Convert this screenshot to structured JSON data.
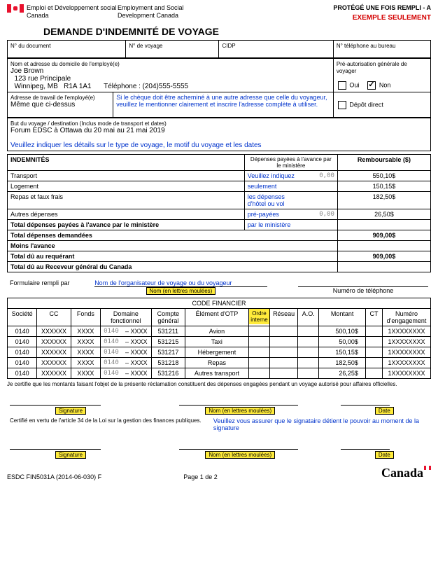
{
  "header": {
    "dept_fr": "Emploi et Développement social Canada",
    "dept_en": "Employment and Social Development Canada",
    "protected": "PROTÉGÉ UNE FOIS REMPLI - A",
    "example": "EXEMPLE SEULEMENT",
    "title": "DEMANDE D'INDEMNITÉ DE VOYAGE"
  },
  "toprow": {
    "doc_label": "N° du document",
    "voyage_label": "N° de voyage",
    "cidp_label": "CIDP",
    "phone_label": "N° téléphone au bureau"
  },
  "employee": {
    "addr_label": "Nom et adresse du domicile de l'employé(e)",
    "line1": "Joe Brown",
    "line2": "  123 rue Principale",
    "line3": "  Winnipeg, MB   R1A 1A1",
    "phone_label": "Téléphone :",
    "phone": "(204)555-5555",
    "preauth_label": "Pré-autorisation générale de voyager",
    "oui": "Oui",
    "non": "Non"
  },
  "work": {
    "addr_label": "Adresse de travail de l'employé(e)",
    "value": "Même que ci-dessus",
    "note": "Si le chèque doit être acheminé à une autre adresse que celle du voyageur, veuillez le mentionner clairement et inscrire l'adresse complète à utiliser.",
    "depot": "Dépôt direct"
  },
  "purpose": {
    "label": "But du voyage / destination (Inclus mode de transport et dates)",
    "value": "Forum EDSC à Ottawa du 20 mai au 21 mai 2019",
    "note": "Veuillez indiquer les détails sur le type de voyage, le motif du voyage et les dates"
  },
  "indemn": {
    "head_label": "INDEMNITÉS",
    "head_paid": "Dépenses payées à l'avance par le ministère",
    "head_reimb": "Remboursable ($)",
    "rows": [
      {
        "label": "Transport",
        "pre": "0,00",
        "reimb": "550,10$"
      },
      {
        "label": "Logement",
        "pre": "",
        "reimb": "150,15$"
      },
      {
        "label": "Repas et faux frais",
        "pre": "",
        "reimb": "182,50$"
      },
      {
        "label": "Autres dépenses",
        "pre": "0,00",
        "reimb": "26,50$"
      }
    ],
    "note_lines": [
      "Veuillez indiquez",
      "seulement",
      "les dépenses",
      "d'hôtel ou vol",
      "pré-payées",
      "par le ministère"
    ],
    "total_pre_label": "Total dépenses payées à l'avance par le ministère",
    "total_demand_label": "Total dépenses demandées",
    "total_demand": "909,00$",
    "moins_label": "Moins l'avance",
    "total_req_label": "Total dû au requérant",
    "total_req": "909,00$",
    "total_rec_label": "Total dû au Receveur général du Canada"
  },
  "filler": {
    "label": "Formulaire rempli par",
    "note": "Nom de l'organisateur de voyage ou du voyageur",
    "name_label": "Nom (en lettres moulées)",
    "phone_label": "Numéro de téléphone"
  },
  "code": {
    "title": "CODE FINANCIER",
    "cols": {
      "societe": "Société",
      "cc": "CC",
      "fonds": "Fonds",
      "domaine": "Domaine fonctionnel",
      "compte": "Compte général",
      "element": "Élément d'OTP",
      "ordre": "Ordre interne",
      "reseau": "Réseau",
      "ao": "A.O.",
      "montant": "Montant",
      "ct": "CT",
      "engagement": "Numéro d'engagement"
    },
    "rows": [
      {
        "soc": "0140",
        "cc": "XXXXXX",
        "fonds": "XXXX",
        "dom1": "0140",
        "dom2": "– XXXX",
        "compte": "531211",
        "elem": "Avion",
        "montant": "500,10$",
        "eng": "1XXXXXXXX"
      },
      {
        "soc": "0140",
        "cc": "XXXXXX",
        "fonds": "XXXX",
        "dom1": "0140",
        "dom2": "– XXXX",
        "compte": "531215",
        "elem": "Taxi",
        "montant": "50,00$",
        "eng": "1XXXXXXXX"
      },
      {
        "soc": "0140",
        "cc": "XXXXXX",
        "fonds": "XXXX",
        "dom1": "0140",
        "dom2": "– XXXX",
        "compte": "531217",
        "elem": "Hébergement",
        "montant": "150,15$",
        "eng": "1XXXXXXXX"
      },
      {
        "soc": "0140",
        "cc": "XXXXXX",
        "fonds": "XXXX",
        "dom1": "0140",
        "dom2": "– XXXX",
        "compte": "531218",
        "elem": "Repas",
        "montant": "182,50$",
        "eng": "1XXXXXXXX"
      },
      {
        "soc": "0140",
        "cc": "XXXXXX",
        "fonds": "XXXX",
        "dom1": "0140",
        "dom2": "– XXXX",
        "compte": "531216",
        "elem": "Autres transport",
        "montant": "26,25$",
        "eng": "1XXXXXXXX"
      }
    ]
  },
  "cert": {
    "line": "Je certifie que les montants faisant l'objet de la présente réclamation constituent des dépenses engagées pendant un voyage autorisé pour affaires officielles.",
    "signature": "Signature",
    "name": "Nom (en lettres moulées)",
    "date": "Date",
    "art34": "Certifié en vertu de l'article 34 de la Loi sur la gestion des finances publiques.",
    "warn": "Veuillez vous assurer que le signataire détient le pouvoir au moment de la signature"
  },
  "footer": {
    "form": "ESDC FIN5031A (2014-06-030) F",
    "page": "Page 1 de 2",
    "wordmark": "Canada"
  }
}
